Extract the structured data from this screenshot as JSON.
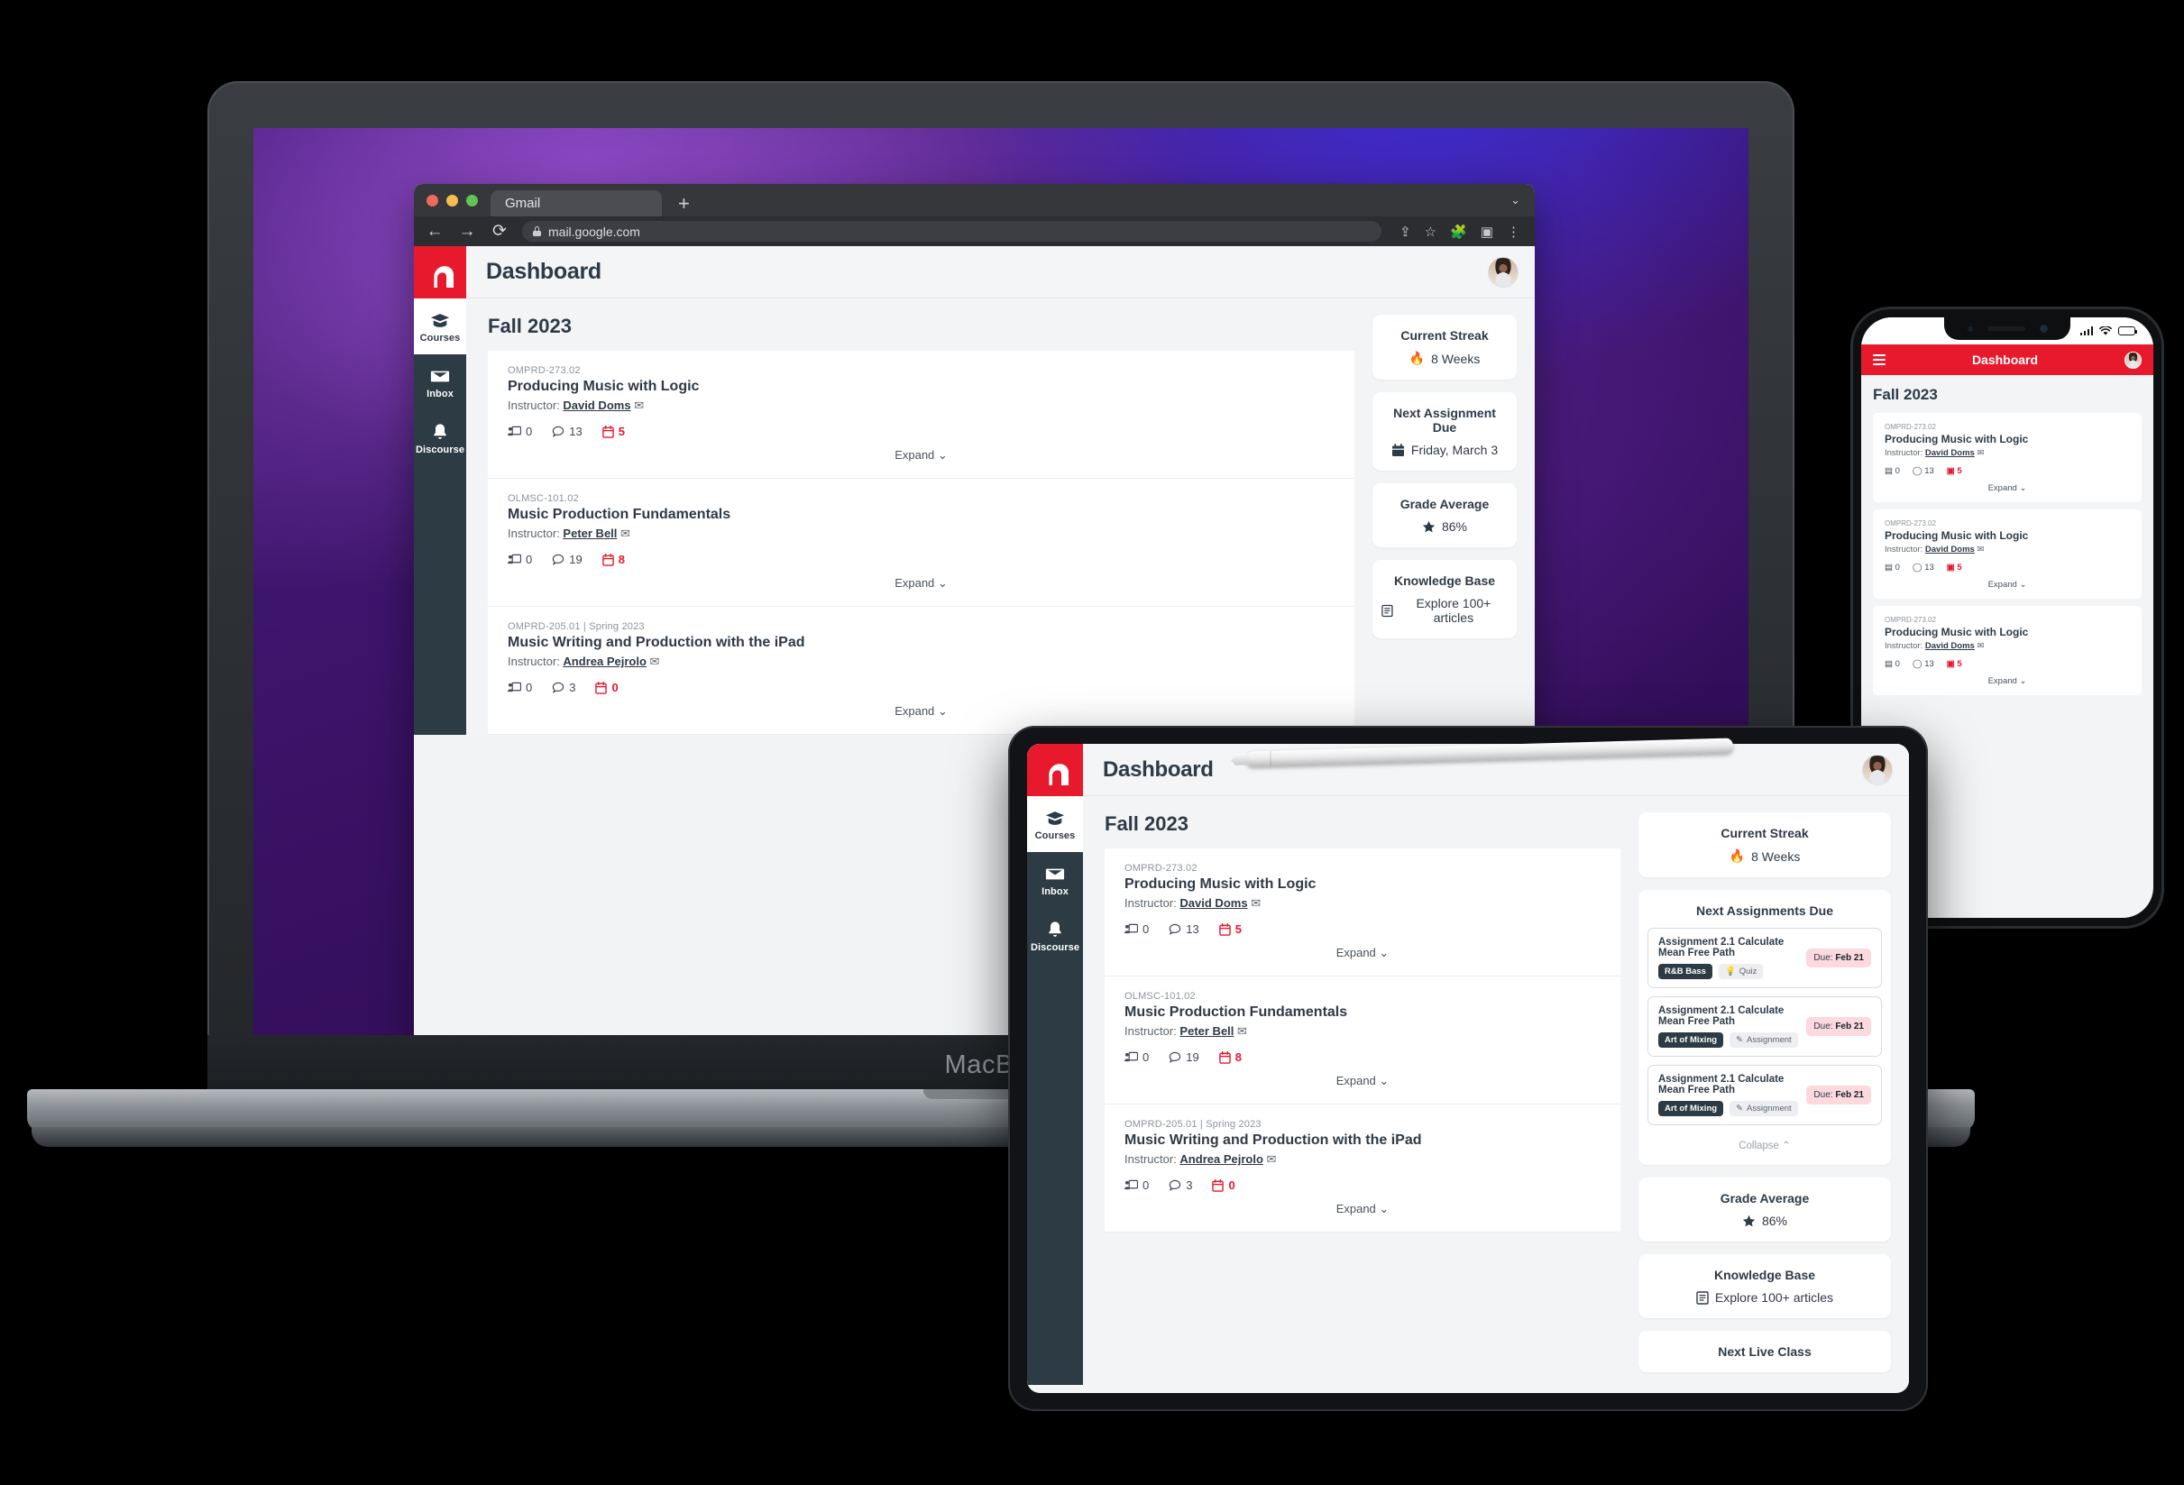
{
  "browser": {
    "tab_label": "Gmail",
    "new_tab_label": "+",
    "url": "mail.google.com",
    "icons": {
      "back": "back-arrow-icon",
      "forward": "forward-arrow-icon",
      "reload": "reload-icon",
      "lock": "lock-icon",
      "share": "share-icon",
      "bookmark": "star-icon",
      "extensions": "puzzle-icon",
      "sidepanel": "side-panel-icon",
      "menu": "three-dot-menu-icon"
    }
  },
  "device_labels": {
    "laptop": "MacBook"
  },
  "app": {
    "title": "Dashboard",
    "brand_color": "#e8192c",
    "sidebar_color": "#2d3b44",
    "logo_name": "berklee-h-logo",
    "nav": [
      {
        "label": "Courses",
        "icon": "graduation-cap-icon",
        "active": true
      },
      {
        "label": "Inbox",
        "icon": "envelope-icon",
        "active": false
      },
      {
        "label": "Discourse",
        "icon": "bell-icon",
        "active": false
      }
    ],
    "term": "Fall 2023",
    "expand_label": "Expand",
    "collapse_label": "Collapse",
    "instructor_prefix": "Instructor:",
    "courses": [
      {
        "code": "OMPRD-273.02",
        "title": "Producing Music with Logic",
        "instructor": "David Doms",
        "announcements": "0",
        "discussions": "13",
        "due": "5"
      },
      {
        "code": "OLMSC-101.02",
        "title": "Music Production Fundamentals",
        "instructor": "Peter Bell",
        "announcements": "0",
        "discussions": "19",
        "due": "8"
      },
      {
        "code": "OMPRD-205.01 | Spring 2023",
        "title": "Music Writing and Production with the iPad",
        "instructor": "Andrea Pejrolo",
        "announcements": "0",
        "discussions": "3",
        "due": "0"
      }
    ],
    "widgets": {
      "streak": {
        "title": "Current Streak",
        "value": "8 Weeks",
        "icon": "fire-icon"
      },
      "next_due": {
        "title": "Next Assignment Due",
        "value": "Friday, March 3",
        "icon": "calendar-icon"
      },
      "grade": {
        "title": "Grade Average",
        "value": "86%",
        "icon": "star-icon"
      },
      "kb": {
        "title": "Knowledge Base",
        "value": "Explore 100+ articles",
        "icon": "book-icon"
      },
      "next_live": {
        "title": "Next Live Class"
      },
      "assignments_title": "Next Assignments Due"
    },
    "assignments": [
      {
        "title": "Assignment 2.1 Calculate Mean Free Path",
        "course_tag": "R&B Bass",
        "type_tag": "Quiz",
        "type_icon": "lightbulb-icon",
        "due_prefix": "Due:",
        "due_date": "Feb 21"
      },
      {
        "title": "Assignment 2.1 Calculate Mean Free Path",
        "course_tag": "Art of Mixing",
        "type_tag": "Assignment",
        "type_icon": "pencil-icon",
        "due_prefix": "Due:",
        "due_date": "Feb 21"
      },
      {
        "title": "Assignment 2.1 Calculate Mean Free Path",
        "course_tag": "Art of Mixing",
        "type_tag": "Assignment",
        "type_icon": "pencil-icon",
        "due_prefix": "Due:",
        "due_date": "Feb 21"
      }
    ]
  },
  "phone": {
    "title": "Dashboard",
    "term": "Fall 2023",
    "status_icons": [
      "signal-bars-icon",
      "wifi-icon",
      "battery-icon"
    ],
    "menu_icon": "hamburger-menu-icon",
    "cards": [
      {
        "code": "OMPRD-273.02",
        "title": "Producing Music with Logic",
        "instructor": "David Doms",
        "announcements": "0",
        "discussions": "13",
        "due": "5"
      },
      {
        "code": "OMPRD-273.02",
        "title": "Producing Music with Logic",
        "instructor": "David Doms",
        "announcements": "0",
        "discussions": "13",
        "due": "5"
      },
      {
        "code": "OMPRD-273.02",
        "title": "Producing Music with Logic",
        "instructor": "David Doms",
        "announcements": "0",
        "discussions": "13",
        "due": "5"
      }
    ]
  }
}
